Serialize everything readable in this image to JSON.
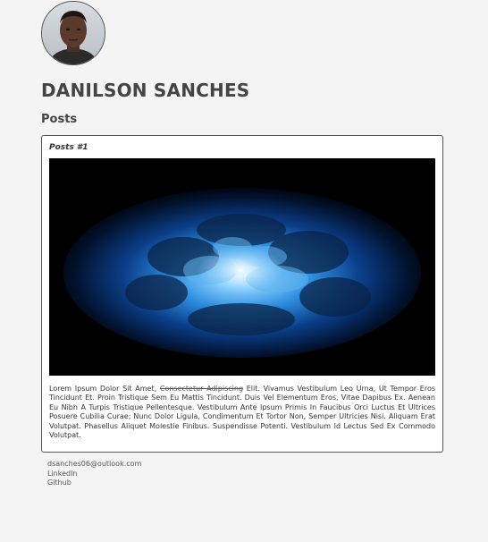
{
  "profile": {
    "name": "DANILSON SANCHES",
    "avatar_icon": "profile-photo"
  },
  "posts_section": {
    "title": "Posts"
  },
  "posts": [
    {
      "title": "Posts #1",
      "image_icon": "blue-nebula-cloud-image",
      "text_before": "Lorem Ipsum Dolor Sit Amet, ",
      "text_strike": "Consectetur Adipiscing",
      "text_after": " Elit. Vivamus Vestibulum Leo Urna, Ut Tempor Eros Tincidunt Et. Proin Tristique Sem Eu Mattis Tincidunt. Duis Vel Elementum Eros, Vitae Dapibus Ex. Aenean Eu Nibh A Turpis Tristique Pellentesque. Vestibulum Ante Ipsum Primis In Faucibus Orci Luctus Et Ultrices Posuere Cubilia Curae; Nunc Dolor Ligula, Condimentum Et Tortor Non, Semper Ultricies Nisi. Aliquam Erat Volutpat. Phasellus Aliquet Molestie Finibus. Suspendisse Potenti. Vestibulum Id Lectus Sed Ex Commodo Volutpat."
    }
  ],
  "footer": {
    "email": "dsanches06@outlook.com",
    "linkedin": "LinkedIn",
    "github": "Github"
  },
  "colors": {
    "background": "#f4f4f4",
    "card": "#ffffff",
    "text": "#333333"
  }
}
